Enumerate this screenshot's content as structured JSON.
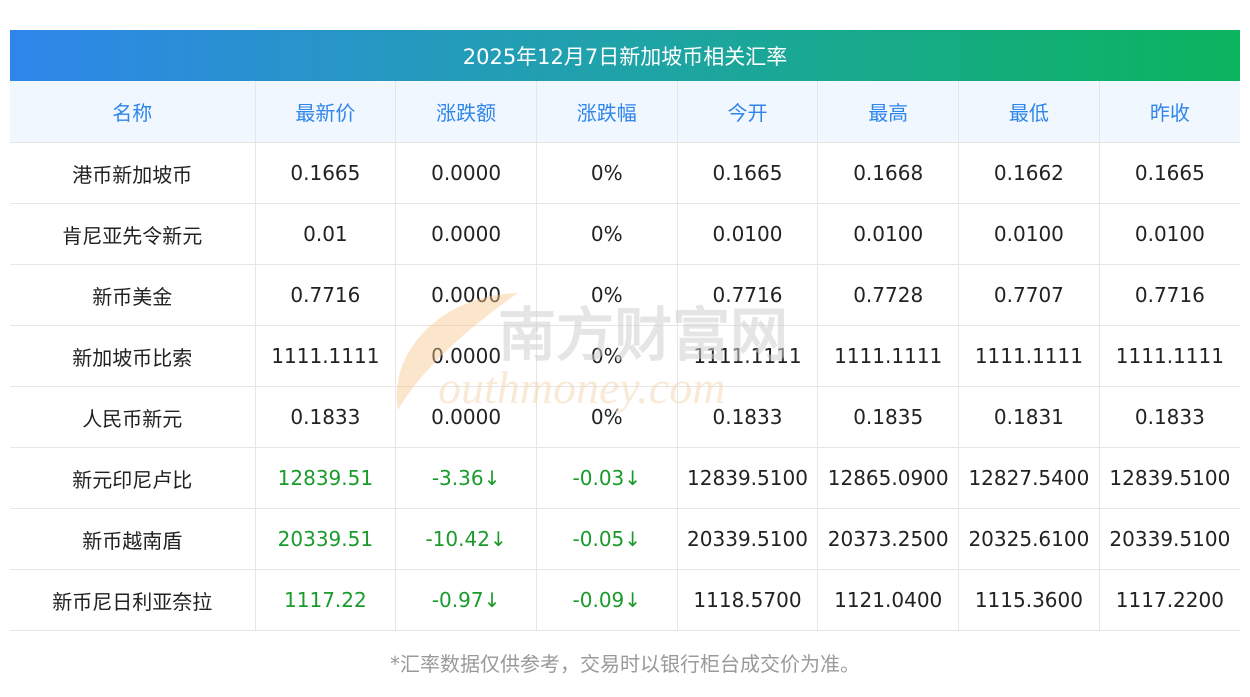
{
  "title": "2025年12月7日新加坡币相关汇率",
  "columns": [
    "名称",
    "最新价",
    "涨跌额",
    "涨跌幅",
    "今开",
    "最高",
    "最低",
    "昨收"
  ],
  "rows": [
    {
      "cells": [
        "港币新加坡币",
        "0.1665",
        "0.0000",
        "0%",
        "0.1665",
        "0.1668",
        "0.1662",
        "0.1665"
      ],
      "trend": "flat"
    },
    {
      "cells": [
        "肯尼亚先令新元",
        "0.01",
        "0.0000",
        "0%",
        "0.0100",
        "0.0100",
        "0.0100",
        "0.0100"
      ],
      "trend": "flat"
    },
    {
      "cells": [
        "新币美金",
        "0.7716",
        "0.0000",
        "0%",
        "0.7716",
        "0.7728",
        "0.7707",
        "0.7716"
      ],
      "trend": "flat"
    },
    {
      "cells": [
        "新加坡币比索",
        "1111.1111",
        "0.0000",
        "0%",
        "1111.1111",
        "1111.1111",
        "1111.1111",
        "1111.1111"
      ],
      "trend": "flat"
    },
    {
      "cells": [
        "人民币新元",
        "0.1833",
        "0.0000",
        "0%",
        "0.1833",
        "0.1835",
        "0.1831",
        "0.1833"
      ],
      "trend": "flat"
    },
    {
      "cells": [
        "新元印尼卢比",
        "12839.51",
        "-3.36↓",
        "-0.03↓",
        "12839.5100",
        "12865.0900",
        "12827.5400",
        "12839.5100"
      ],
      "trend": "down"
    },
    {
      "cells": [
        "新币越南盾",
        "20339.51",
        "-10.42↓",
        "-0.05↓",
        "20339.5100",
        "20373.2500",
        "20325.6100",
        "20339.5100"
      ],
      "trend": "down"
    },
    {
      "cells": [
        "新币尼日利亚奈拉",
        "1117.22",
        "-0.97↓",
        "-0.09↓",
        "1118.5700",
        "1121.0400",
        "1115.3600",
        "1117.2200"
      ],
      "trend": "down"
    }
  ],
  "watermark": {
    "cn": "南方财富网",
    "en": "outhmoney.com"
  },
  "footnote": "*汇率数据仅供参考，交易时以银行柜台成交价为准。",
  "colors": {
    "header_text": "#2f86ea",
    "header_bg": "#f1f7fe",
    "change_down": "#1a9b2b",
    "title_gradient": [
      "#2f86ea",
      "#0bb45e"
    ]
  }
}
